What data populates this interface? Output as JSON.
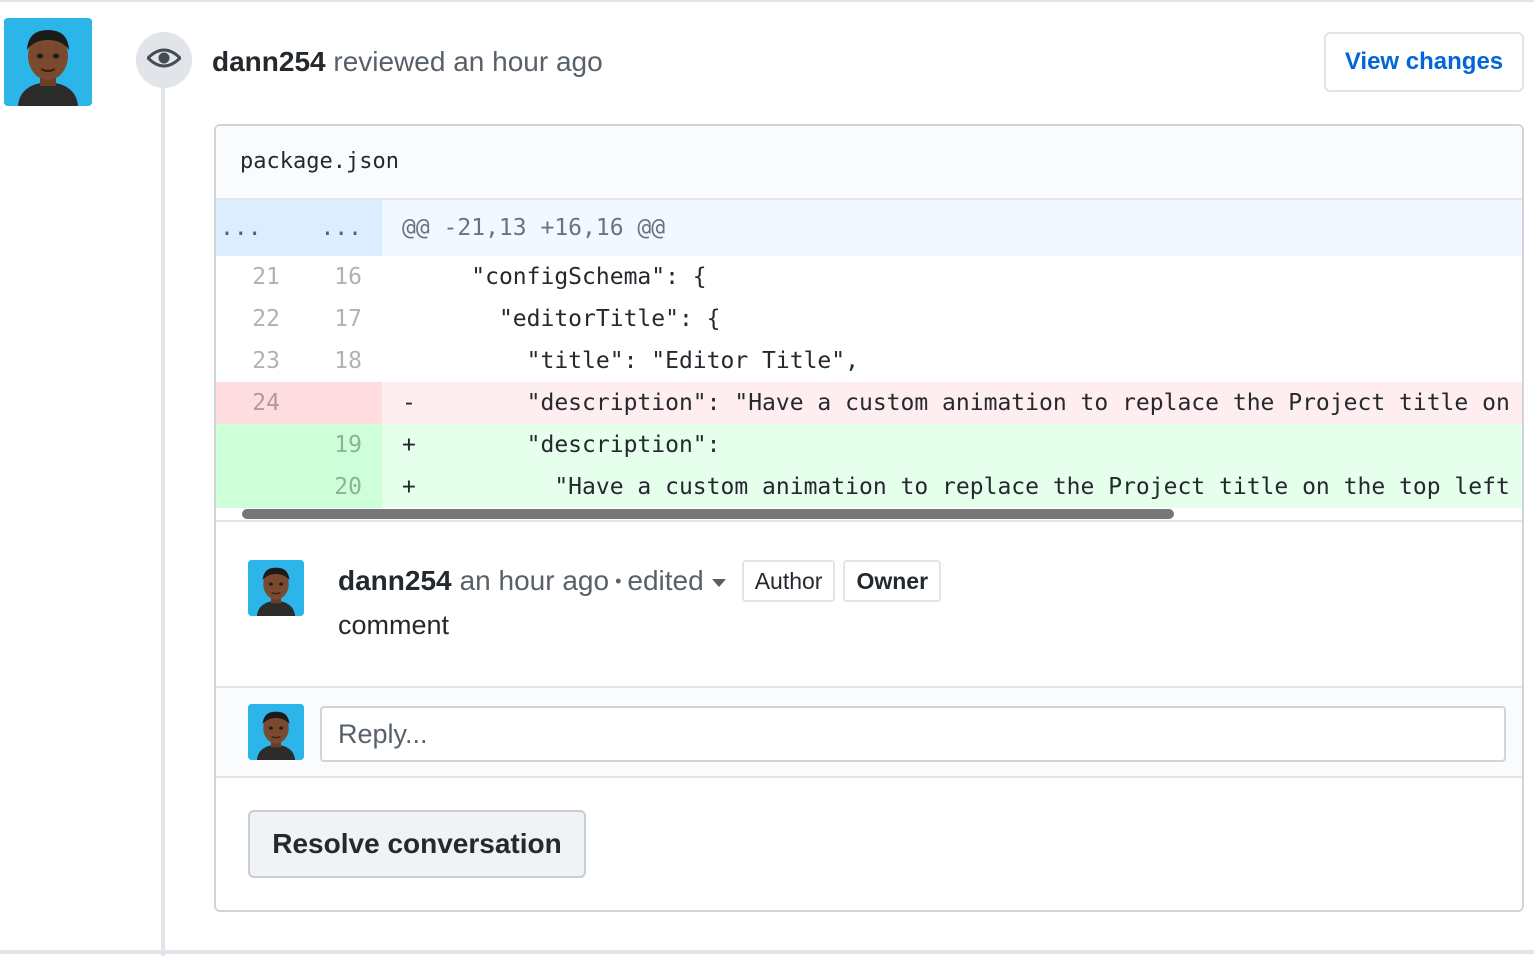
{
  "review": {
    "author": "dann254",
    "action": "reviewed",
    "time": "an hour ago",
    "view_changes_label": "View changes",
    "icon": "eye-icon"
  },
  "file": {
    "name": "package.json"
  },
  "diff": {
    "hunk": {
      "old_marker": "...",
      "new_marker": "...",
      "header": "@@ -21,13 +16,16 @@"
    },
    "lines": [
      {
        "old": "21",
        "new": "16",
        "sign": " ",
        "code": "  \"configSchema\": {",
        "type": "context"
      },
      {
        "old": "22",
        "new": "17",
        "sign": " ",
        "code": "    \"editorTitle\": {",
        "type": "context"
      },
      {
        "old": "23",
        "new": "18",
        "sign": " ",
        "code": "      \"title\": \"Editor Title\",",
        "type": "context"
      },
      {
        "old": "24",
        "new": "",
        "sign": "-",
        "code": "      \"description\": \"Have a custom animation to replace the Project title on the top left corner of the editor\",",
        "type": "deletion"
      },
      {
        "old": "",
        "new": "19",
        "sign": "+",
        "code": "      \"description\":",
        "type": "addition"
      },
      {
        "old": "",
        "new": "20",
        "sign": "+",
        "code": "        \"Have a custom animation to replace the Project title on the top left corner of the editor\",",
        "type": "addition"
      }
    ]
  },
  "comment": {
    "author": "dann254",
    "time": "an hour ago",
    "separator": "•",
    "edited": "edited",
    "labels": [
      "Author",
      "Owner"
    ],
    "body": "comment"
  },
  "reply": {
    "placeholder": "Reply..."
  },
  "resolve_label": "Resolve conversation",
  "colors": {
    "link": "#0366d6",
    "deletion_bg": "#ffeef0",
    "addition_bg": "#e6ffed",
    "hunk_bg": "#f1f8ff"
  }
}
